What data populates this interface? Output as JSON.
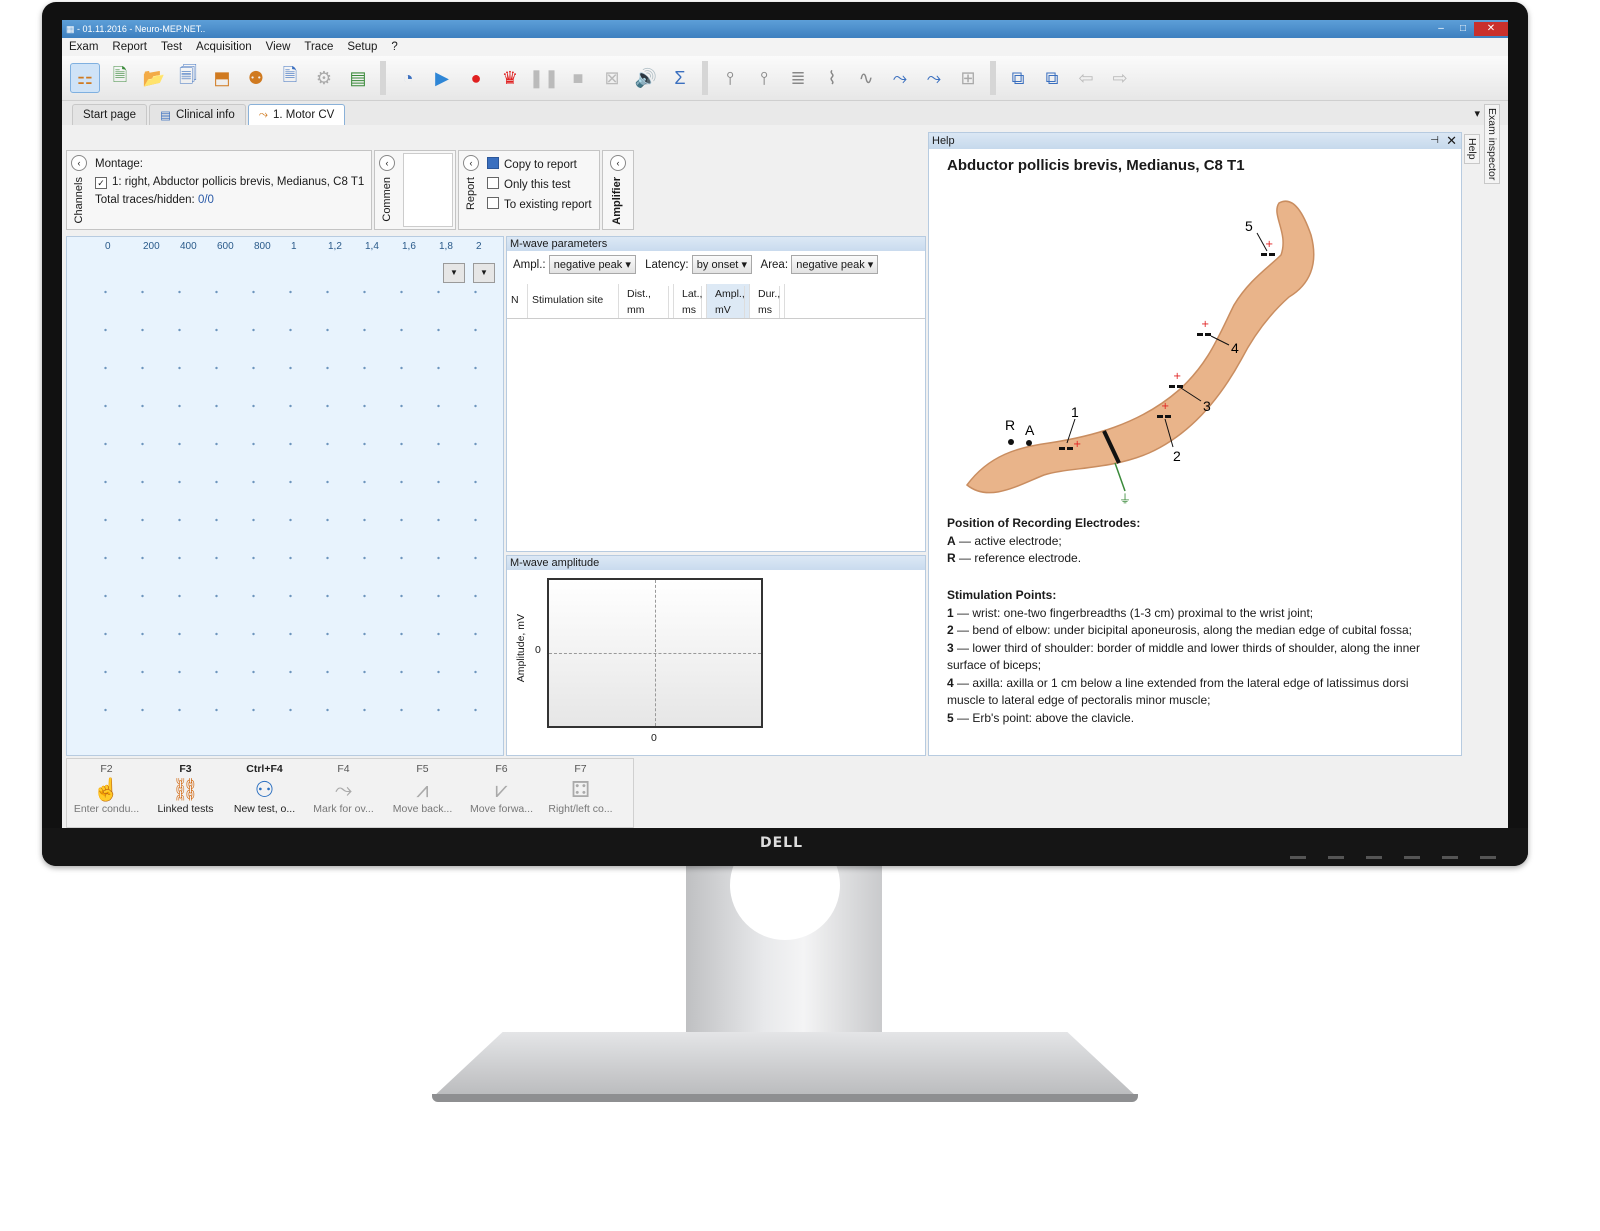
{
  "window": {
    "title": "- 01.11.2016 - Neuro-MEP.NET.."
  },
  "menu": [
    "Exam",
    "Report",
    "Test",
    "Acquisition",
    "View",
    "Trace",
    "Setup",
    "?"
  ],
  "tabs": [
    {
      "label": "Start page"
    },
    {
      "label": "Clinical info"
    },
    {
      "label": "1. Motor CV"
    }
  ],
  "channel": {
    "vertical_label": "Channels",
    "montage_label": "Montage:",
    "item": "1: right, Abductor pollicis brevis, Medianus, C8 T1",
    "totals_label": "Total traces/hidden:",
    "totals_value": "0/0"
  },
  "comment": {
    "vertical_label": "Commen"
  },
  "report": {
    "vertical_label": "Report",
    "copy": "Copy to report",
    "only": "Only this test",
    "existing": "To existing report"
  },
  "amplifier": {
    "vertical_label": "Amplifier"
  },
  "trace_axis": [
    "0",
    "200",
    "400",
    "600",
    "800",
    "1",
    "1,2",
    "1,4",
    "1,6",
    "1,8",
    "2"
  ],
  "mwave": {
    "title": "M-wave parameters",
    "ampl_label": "Ampl.:",
    "ampl_value": "negative peak",
    "latency_label": "Latency:",
    "latency_value": "by onset",
    "area_label": "Area:",
    "area_value": "negative peak",
    "columns": [
      {
        "l1": "N",
        "l2": ""
      },
      {
        "l1": "Stimulation site",
        "l2": ""
      },
      {
        "l1": "Dist.,",
        "l2": "mm"
      },
      {
        "l1": "Lat.,",
        "l2": "ms"
      },
      {
        "l1": "Ampl.,",
        "l2": "mV"
      },
      {
        "l1": "Dur.,",
        "l2": "ms"
      }
    ]
  },
  "amplitude": {
    "title": "M-wave amplitude",
    "ylabel": "Amplitude, mV",
    "ytick": "0",
    "xtick": "0"
  },
  "fkeys": [
    {
      "key": "F2",
      "label": "Enter condu...",
      "active": false
    },
    {
      "key": "F3",
      "label": "Linked tests",
      "active": true
    },
    {
      "key": "Ctrl+F4",
      "label": "New test, o...",
      "active": true
    },
    {
      "key": "F4",
      "label": "Mark for ov...",
      "active": false
    },
    {
      "key": "F5",
      "label": "Move back...",
      "active": false
    },
    {
      "key": "F6",
      "label": "Move forwa...",
      "active": false
    },
    {
      "key": "F7",
      "label": "Right/left co...",
      "active": false
    }
  ],
  "help": {
    "header": "Help",
    "title": "Abductor pollicis brevis, Medianus, C8 T1",
    "rec_title": "Position of Recording Electrodes:",
    "rec_a_key": "A",
    "rec_a": " — active electrode;",
    "rec_r_key": "R",
    "rec_r": " — reference electrode.",
    "stim_title": "Stimulation Points:",
    "p1": "1",
    "p1t": " — wrist: one-two fingerbreadths (1-3 cm) proximal to the wrist joint;",
    "p2": "2",
    "p2t": " — bend of elbow: under bicipital aponeurosis, along the median edge of cubital fossa;",
    "p3": "3",
    "p3t": " — lower third of shoulder: border of middle and lower thirds of shoulder, along the inner surface of biceps;",
    "p4": "4",
    "p4t": " — axilla: axilla or 1 cm below a line extended from the lateral edge of latissimus dorsi muscle to lateral edge of pectoralis minor muscle;",
    "p5": "5",
    "p5t": " — Erb's point: above the clavicle.",
    "fig_labels": {
      "r": "R",
      "a": "A",
      "n1": "1",
      "n2": "2",
      "n3": "3",
      "n4": "4",
      "n5": "5"
    }
  },
  "side_tabs": [
    "Exam inspector",
    "Help"
  ],
  "brand": "DELL"
}
